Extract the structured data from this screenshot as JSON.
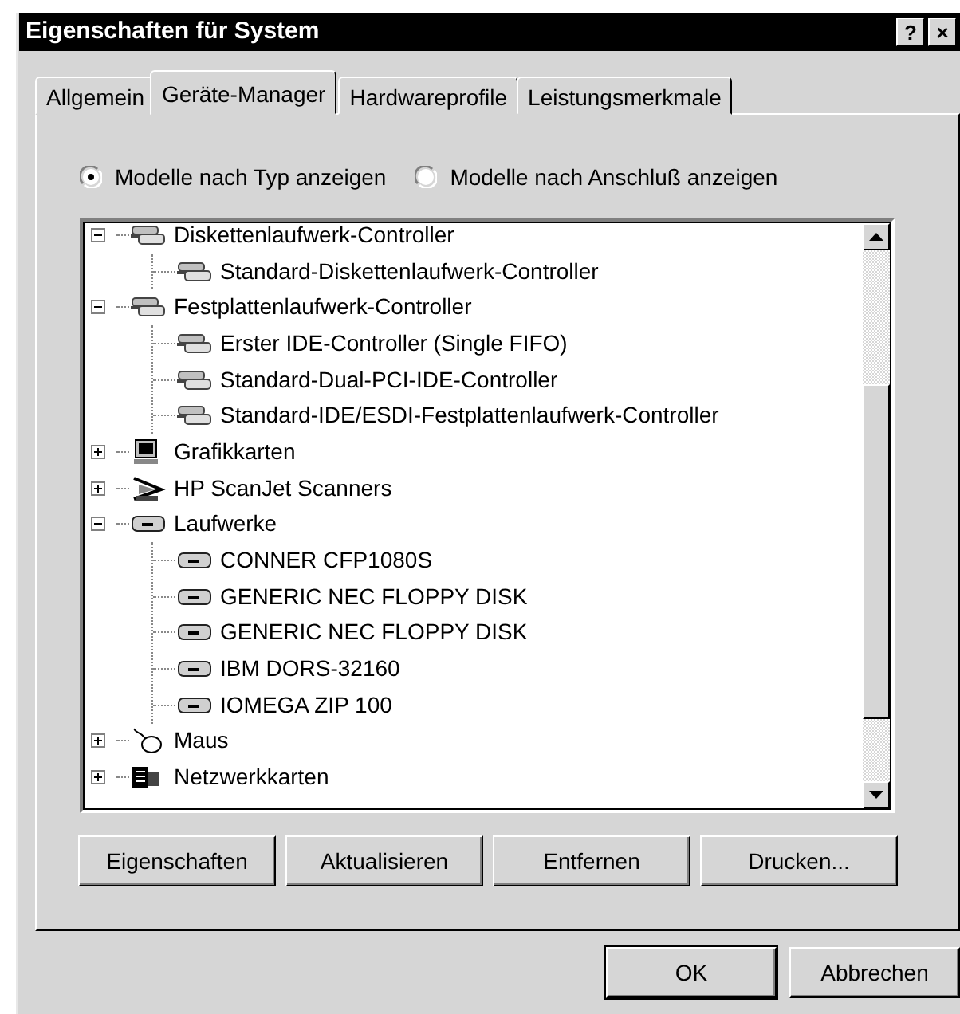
{
  "window": {
    "title": "Eigenschaften für System",
    "title_buttons": [
      "?",
      "×"
    ]
  },
  "tabs": [
    {
      "label": "Allgemein",
      "selected": false
    },
    {
      "label": "Geräte-Manager",
      "selected": true
    },
    {
      "label": "Hardwareprofile",
      "selected": false
    },
    {
      "label": "Leistungsmerkmale",
      "selected": false
    }
  ],
  "view_options": [
    {
      "label": "Modelle nach Typ anzeigen",
      "selected": true
    },
    {
      "label": "Modelle nach Anschluß anzeigen",
      "selected": false
    }
  ],
  "devices": [
    {
      "label": "Diskettenlaufwerk-Controller",
      "kind": "controller",
      "expanded": true,
      "children": [
        {
          "label": "Standard-Diskettenlaufwerk-Controller",
          "kind": "controller"
        }
      ]
    },
    {
      "label": "Festplattenlaufwerk-Controller",
      "kind": "controller",
      "expanded": true,
      "children": [
        {
          "label": "Erster IDE-Controller (Single FIFO)",
          "kind": "controller"
        },
        {
          "label": "Standard-Dual-PCI-IDE-Controller",
          "kind": "controller"
        },
        {
          "label": "Standard-IDE/ESDI-Festplattenlaufwerk-Controller",
          "kind": "controller"
        }
      ]
    },
    {
      "label": "Grafikkarten",
      "kind": "display",
      "expanded": false
    },
    {
      "label": "HP ScanJet Scanners",
      "kind": "scanner",
      "expanded": false
    },
    {
      "label": "Laufwerke",
      "kind": "drive",
      "expanded": true,
      "children": [
        {
          "label": "CONNER CFP1080S",
          "kind": "drive"
        },
        {
          "label": "GENERIC NEC  FLOPPY DISK",
          "kind": "drive"
        },
        {
          "label": "GENERIC NEC  FLOPPY DISK",
          "kind": "drive"
        },
        {
          "label": "IBM DORS-32160",
          "kind": "drive"
        },
        {
          "label": "IOMEGA ZIP 100",
          "kind": "drive"
        }
      ]
    },
    {
      "label": "Maus",
      "kind": "mouse",
      "expanded": false
    },
    {
      "label": "Netzwerkkarten",
      "kind": "network",
      "expanded": false
    }
  ],
  "device_buttons": [
    {
      "label": "Eigenschaften"
    },
    {
      "label": "Aktualisieren"
    },
    {
      "label": "Entfernen"
    },
    {
      "label": "Drucken..."
    }
  ],
  "dialog_buttons": [
    {
      "label": "OK",
      "default": true
    },
    {
      "label": "Abbrechen",
      "default": false
    }
  ]
}
